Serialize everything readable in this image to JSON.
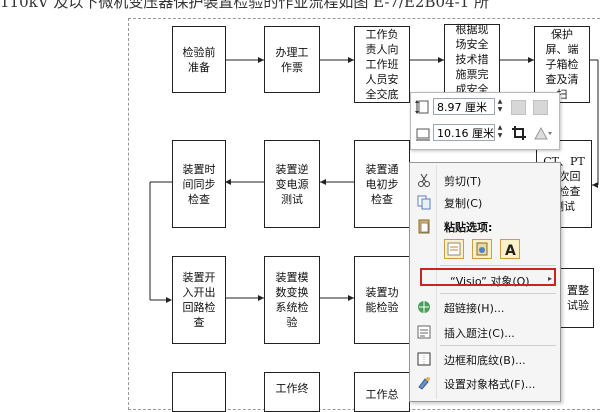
{
  "document": {
    "title": "110kV 及以下微机变压器保护装置检验的作业流程如图 E-7/E2B04-1 所"
  },
  "flowchart": {
    "boxes": [
      {
        "name": "box-inspection-prep",
        "lines": [
          "检验前",
          "准备"
        ]
      },
      {
        "name": "box-work-ticket",
        "lines": [
          "办理工",
          "作票"
        ]
      },
      {
        "name": "box-safety-briefing",
        "lines": [
          "工作负",
          "责人向",
          "工作班",
          "人员安",
          "全交底"
        ]
      },
      {
        "name": "box-safety-measures",
        "lines": [
          "根据现",
          "场安全",
          "技术措",
          "施票完",
          "成安全"
        ]
      },
      {
        "name": "box-protection-panel",
        "lines": [
          "保护",
          "屏、端",
          "子箱检",
          "查及清",
          "扫"
        ]
      },
      {
        "name": "box-time-sync",
        "lines": [
          "装置时",
          "间同步",
          "检查"
        ]
      },
      {
        "name": "box-dc-power-test",
        "lines": [
          "装置逆",
          "变电源",
          "测试"
        ]
      },
      {
        "name": "box-power-on-check",
        "lines": [
          "装置通",
          "电初步",
          "检查"
        ]
      },
      {
        "name": "box-ct-pt-check",
        "lines": [
          "CT、PT",
          "二次回",
          "路检查",
          "测试"
        ]
      },
      {
        "name": "box-io-circuit",
        "lines": [
          "装置开",
          "入开出",
          "回路检",
          "查"
        ]
      },
      {
        "name": "box-analog-conversion",
        "lines": [
          "装置模",
          "数变换",
          "系统检",
          "验"
        ]
      },
      {
        "name": "box-function-check",
        "lines": [
          "装置功",
          "能检验"
        ]
      },
      {
        "name": "box-setting-test",
        "lines": [
          "置整",
          "试验"
        ]
      },
      {
        "name": "box-work-end",
        "lines": [
          "工作终"
        ]
      },
      {
        "name": "box-work-end-2",
        "lines": [
          "工作总"
        ]
      }
    ]
  },
  "mini_toolbar": {
    "height_value": "8.97 厘米",
    "width_value": "10.16 厘米",
    "icons": [
      "shape-height-icon",
      "shape-width-icon",
      "bring-forward-icon",
      "send-backward-icon",
      "crop-icon",
      "wrap-text-icon"
    ]
  },
  "context_menu": {
    "items": {
      "cut": "剪切(T)",
      "copy": "复制(C)",
      "paste_options": "粘贴选项:",
      "visio_object": "“Visio” 对象(O)",
      "hyperlink": "超链接(H)...",
      "insert_caption": "插入题注(C)...",
      "borders_shading": "边框和底纹(B)...",
      "format_object": "设置对象格式(F)..."
    },
    "highlight_color": "#cc2222"
  }
}
